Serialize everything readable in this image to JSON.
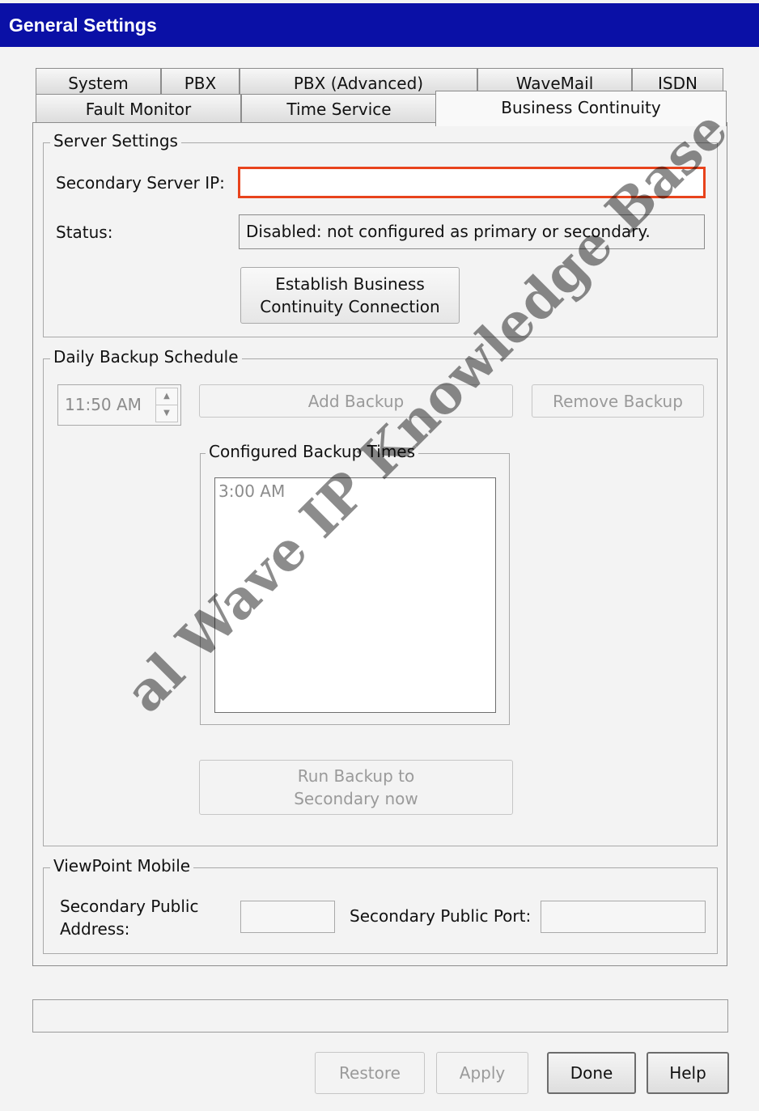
{
  "window": {
    "title": "General Settings"
  },
  "tabs": {
    "row1": [
      "System",
      "PBX",
      "PBX (Advanced)",
      "WaveMail",
      "ISDN"
    ],
    "row2": [
      "Fault Monitor",
      "Time Service",
      "Business Continuity"
    ],
    "active": "Business Continuity"
  },
  "server_settings": {
    "legend": "Server Settings",
    "secondary_ip_label": "Secondary Server IP:",
    "secondary_ip_value": "",
    "status_label": "Status:",
    "status_value": "Disabled: not configured as primary or secondary.",
    "establish_button_line1": "Establish Business",
    "establish_button_line2": "Continuity Connection",
    "accent_color": "#e8431c"
  },
  "daily_backup": {
    "legend": "Daily Backup Schedule",
    "time_value": "11:50 AM",
    "add_label": "Add Backup",
    "remove_label": "Remove Backup",
    "configured_legend": "Configured Backup Times",
    "configured_times": [
      "3:00 AM"
    ],
    "run_button_line1": "Run Backup to",
    "run_button_line2": "Secondary now"
  },
  "viewpoint_mobile": {
    "legend": "ViewPoint Mobile",
    "public_address_line1": "Secondary Public",
    "public_address_line2": "Address:",
    "public_address_value": "",
    "public_port_label": "Secondary Public Port:",
    "public_port_value": ""
  },
  "footer": {
    "status_value": "",
    "restore_label": "Restore",
    "apply_label": "Apply",
    "done_label": "Done",
    "help_label": "Help"
  },
  "watermark": "al Wave IP Knowledge Base"
}
